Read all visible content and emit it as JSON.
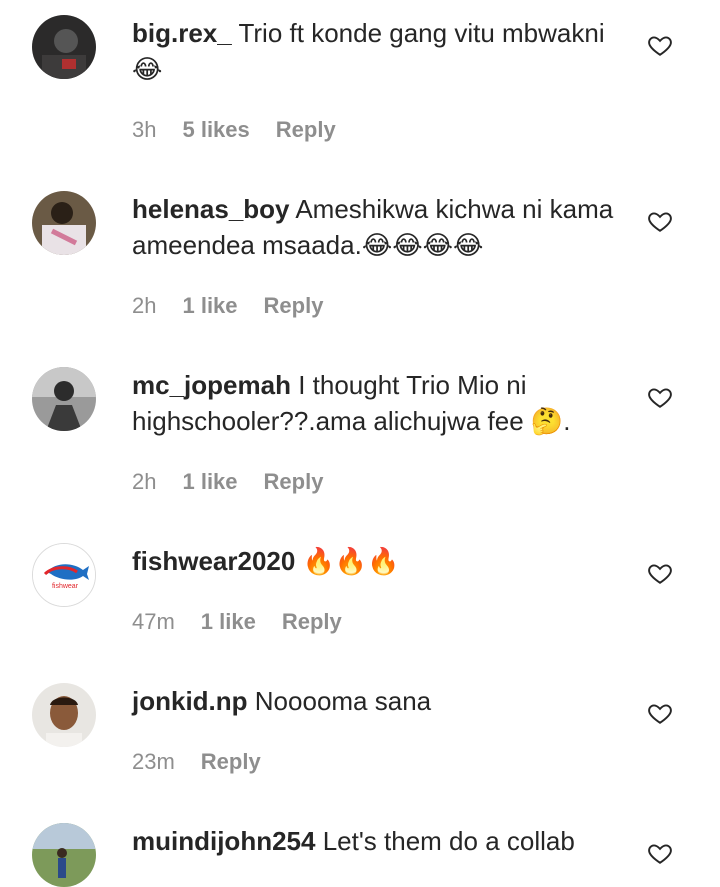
{
  "comments": [
    {
      "username": "big.rex_",
      "text": "Trio ft konde gang vitu mbwakni😂",
      "time": "3h",
      "likes": "5 likes",
      "reply": "Reply",
      "avatar": "avatar-dark-photo"
    },
    {
      "username": "helenas_boy",
      "text": "Ameshikwa kichwa ni kama ameendea msaada.😂😂😂😂",
      "time": "2h",
      "likes": "1 like",
      "reply": "Reply",
      "avatar": "avatar-person-photo"
    },
    {
      "username": "mc_jopemah",
      "text": "I thought Trio Mio ni highschooler??.ama alichujwa fee 🤔.",
      "time": "2h",
      "likes": "1 like",
      "reply": "Reply",
      "avatar": "avatar-bw-photo"
    },
    {
      "username": "fishwear2020",
      "text": "🔥🔥🔥",
      "time": "47m",
      "likes": "1 like",
      "reply": "Reply",
      "avatar": "fishwear-logo",
      "logo_text": "fishwear"
    },
    {
      "username": "jonkid.np",
      "text": "Nooooma sana",
      "time": "23m",
      "likes": "",
      "reply": "Reply",
      "avatar": "avatar-face-photo"
    },
    {
      "username": "muindijohn254",
      "text": "Let's them do a collab",
      "time": "",
      "likes": "",
      "reply": "",
      "avatar": "avatar-outdoor-photo"
    }
  ],
  "icons": {
    "like": "heart-outline-icon"
  },
  "colors": {
    "text": "#262626",
    "meta": "#8e8e8e",
    "background": "#ffffff"
  }
}
